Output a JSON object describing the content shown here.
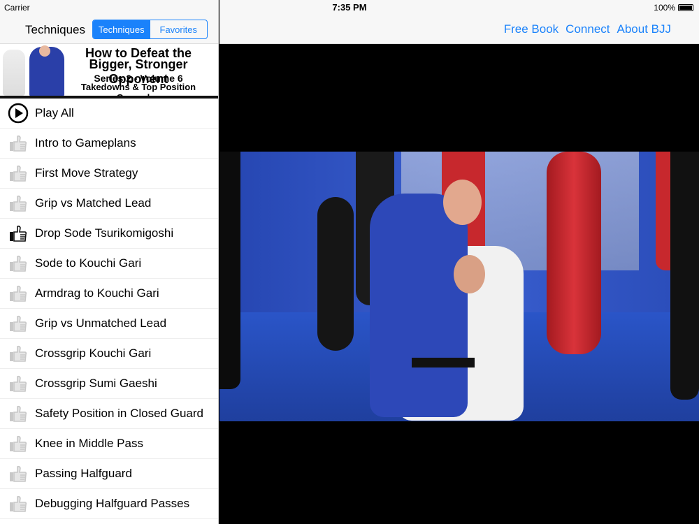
{
  "status": {
    "carrier": "Carrier",
    "time": "7:35 PM",
    "battery": "100%"
  },
  "sidebar": {
    "title": "Techniques",
    "segments": [
      {
        "label": "Techniques",
        "selected": true
      },
      {
        "label": "Favorites",
        "selected": false
      }
    ],
    "banner": {
      "line1": "How to Defeat the",
      "line2": "Bigger, Stronger Opponent",
      "line3": "Series 2 - Volume 6",
      "line4": "Takedowns & Top Position Gameplan"
    },
    "play_all": "Play All",
    "items": [
      {
        "label": "Intro to Gameplans",
        "active": false
      },
      {
        "label": "First Move Strategy",
        "active": false
      },
      {
        "label": "Grip vs Matched Lead",
        "active": false
      },
      {
        "label": "Drop Sode Tsurikomigoshi",
        "active": true
      },
      {
        "label": "Sode to Kouchi Gari",
        "active": false
      },
      {
        "label": "Armdrag to Kouchi Gari",
        "active": false
      },
      {
        "label": "Grip vs Unmatched Lead",
        "active": false
      },
      {
        "label": "Crossgrip Kouchi Gari",
        "active": false
      },
      {
        "label": "Crossgrip Sumi Gaeshi",
        "active": false
      },
      {
        "label": "Safety Position in Closed Guard",
        "active": false
      },
      {
        "label": "Knee in Middle Pass",
        "active": false
      },
      {
        "label": "Passing Halfguard",
        "active": false
      },
      {
        "label": "Debugging Halfguard Passes",
        "active": false
      }
    ]
  },
  "nav": {
    "links": [
      "Free Book",
      "Connect",
      "About BJJ"
    ]
  },
  "colors": {
    "accent": "#1a82fb"
  }
}
